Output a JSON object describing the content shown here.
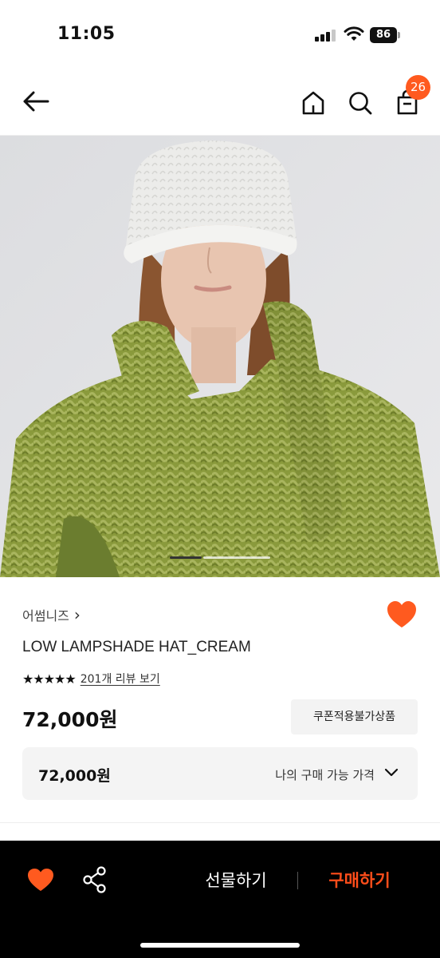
{
  "status_bar": {
    "time": "11:05",
    "battery": "86"
  },
  "nav": {
    "cart_count": "26",
    "icons": [
      "back-arrow-icon",
      "home-icon",
      "search-icon",
      "shopping-bag-icon"
    ]
  },
  "carousel": {
    "active_index": 1,
    "total": 3
  },
  "product": {
    "brand": "어썸니즈",
    "brand_chevron": "›",
    "name": "LOW LAMPSHADE HAT_CREAM",
    "rating": 5,
    "stars": "★★★★★",
    "review_link": "201개 리뷰 보기",
    "price": "72,000원",
    "coupon_label": "쿠폰적용불가상품",
    "my_price_value": "72,000원",
    "my_price_label": "나의 구매 가능 가격"
  },
  "bottom_bar": {
    "gift_label": "선물하기",
    "buy_label": "구매하기"
  },
  "colors": {
    "accent": "#ff4d1a",
    "badge": "#ff5a1f",
    "wish": "#ff5a1f"
  }
}
